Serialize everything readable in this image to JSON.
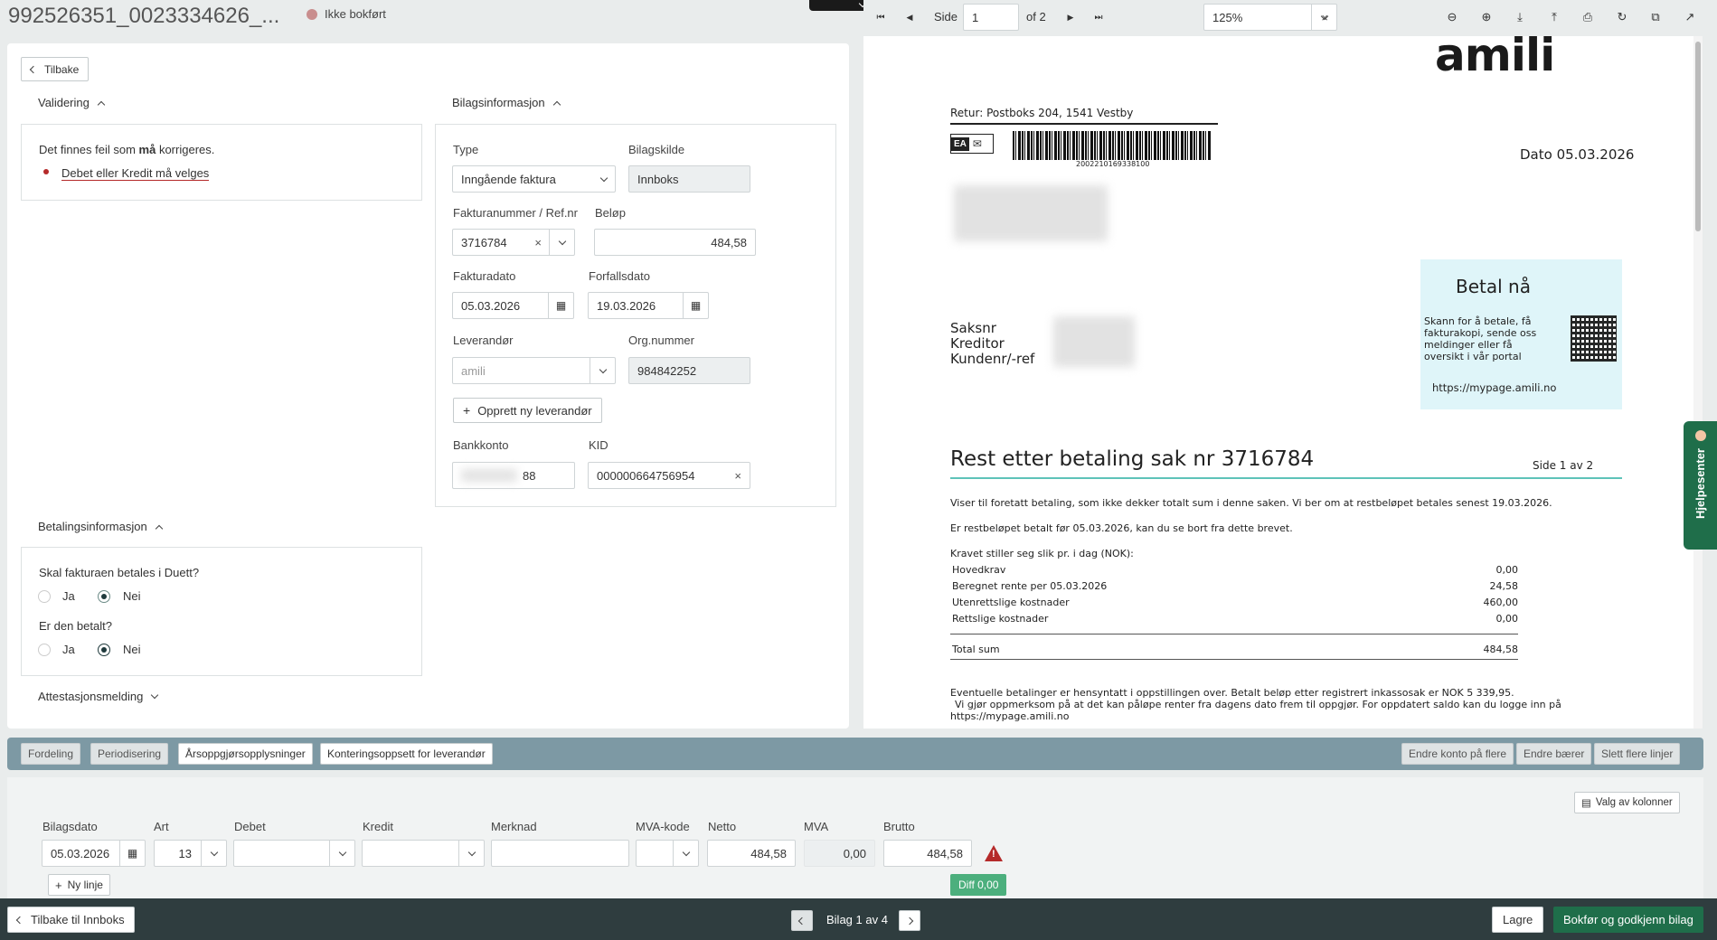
{
  "header": {
    "doc_title": "992526351_0023334626_...",
    "status": "Ikke bokført"
  },
  "left": {
    "back_label": "Tilbake",
    "validering": {
      "title": "Validering",
      "message_pre": "Det finnes feil som ",
      "message_bold": "må",
      "message_post": " korrigeres.",
      "error_link": "Debet eller Kredit må velges"
    },
    "bilagsinfo": {
      "title": "Bilagsinformasjon",
      "type_label": "Type",
      "type_value": "Inngående faktura",
      "kilde_label": "Bilagskilde",
      "kilde_value": "Innboks",
      "fakturanr_label": "Fakturanummer / Ref.nr",
      "fakturanr_value": "3716784",
      "belop_label": "Beløp",
      "belop_value": "484,58",
      "fakturadato_label": "Fakturadato",
      "fakturadato_value": "05.03.2026",
      "forfallsdato_label": "Forfallsdato",
      "forfallsdato_value": "19.03.2026",
      "leverandor_label": "Leverandør",
      "leverandor_value": "amili",
      "orgnr_label": "Org.nummer",
      "orgnr_value": "984842252",
      "ny_leverandor_label": "Opprett ny leverandør",
      "bankkonto_label": "Bankkonto",
      "bankkonto_suffix": "88",
      "kid_label": "KID",
      "kid_value": "000000664756954"
    },
    "betaling": {
      "title": "Betalingsinformasjon",
      "q1": "Skal fakturaen betales i Duett?",
      "q2": "Er den betalt?",
      "ja": "Ja",
      "nei": "Nei"
    },
    "attest_title": "Attestasjonsmelding"
  },
  "viewer": {
    "side_label": "Side",
    "page_value": "1",
    "of_label": "of 2",
    "zoom_value": "125%"
  },
  "pdf": {
    "logo": "amili",
    "return_addr": "Retur: Postboks 204, 1541 Vestby",
    "barcode_num": "2002210169338100",
    "ea": "EA",
    "date": "Dato 05.03.2026",
    "saksnr": "Saksnr",
    "kreditor": "Kreditor",
    "kundenr": "Kundenr/-ref",
    "pay_title": "Betal nå",
    "pay_text": "Skann for å betale, få fakturakopi, sende oss meldinger eller få oversikt i vår portal",
    "pay_url": "https://mypage.amili.no",
    "heading": "Rest etter betaling sak nr 3716784",
    "page_of": "Side 1 av 2",
    "p1": "Viser til foretatt betaling, som ikke dekker totalt sum i denne saken. Vi ber om at restbeløpet betales senest 19.03.2026.",
    "p2": "Er restbeløpet betalt før 05.03.2026, kan du se bort fra dette brevet.",
    "krav_title": "Kravet stiller seg slik pr. i dag (NOK):",
    "rows": [
      {
        "label": "Hovedkrav",
        "value": "0,00"
      },
      {
        "label": "Beregnet rente per 05.03.2026",
        "value": "24,58"
      },
      {
        "label": "Utenrettslige kostnader",
        "value": "460,00"
      },
      {
        "label": "Rettslige kostnader",
        "value": "0,00"
      }
    ],
    "total_label": "Total sum",
    "total_value": "484,58",
    "foot1": "Eventuelle betalinger er hensyntatt i oppstillingen over. Betalt beløp etter registrert inkassosak er NOK 5 339,95.",
    "foot2": "Vi gjør oppmerksom på at det kan påløpe renter fra dagens dato frem til oppgjør. For oppdatert saldo kan du logge inn på",
    "foot3": "https://mypage.amili.no"
  },
  "helper_label": "Hjelpesenter",
  "toolbar": {
    "fordeling": "Fordeling",
    "periodisering": "Periodisering",
    "arsoppgjor": "Årsoppgjørsopplysninger",
    "kontering": "Konteringsoppsett for leverandør",
    "endre_konto": "Endre konto på flere",
    "endre_baerer": "Endre bærer",
    "slett": "Slett flere linjer"
  },
  "lines": {
    "valg_kolonner": "Valg av kolonner",
    "headers": {
      "bilagsdato": "Bilagsdato",
      "art": "Art",
      "debet": "Debet",
      "kredit": "Kredit",
      "merknad": "Merknad",
      "mva_kode": "MVA-kode",
      "netto": "Netto",
      "mva": "MVA",
      "brutto": "Brutto"
    },
    "row": {
      "bilagsdato": "05.03.2026",
      "art": "13",
      "netto": "484,58",
      "mva": "0,00",
      "brutto": "484,58"
    },
    "ny_linje": "Ny linje",
    "diff": "Diff 0,00"
  },
  "footer": {
    "back_inbox": "Tilbake til Innboks",
    "bilag_nav": "Bilag 1 av 4",
    "lagre": "Lagre",
    "bokfor": "Bokfør og godkjenn bilag"
  },
  "colors": {
    "primary": "#1f6e4a",
    "dark_bar": "#2f3d3f",
    "toolbar_band": "#7d99a4",
    "error": "#b52a2a",
    "pay_box": "#dff5f9"
  }
}
